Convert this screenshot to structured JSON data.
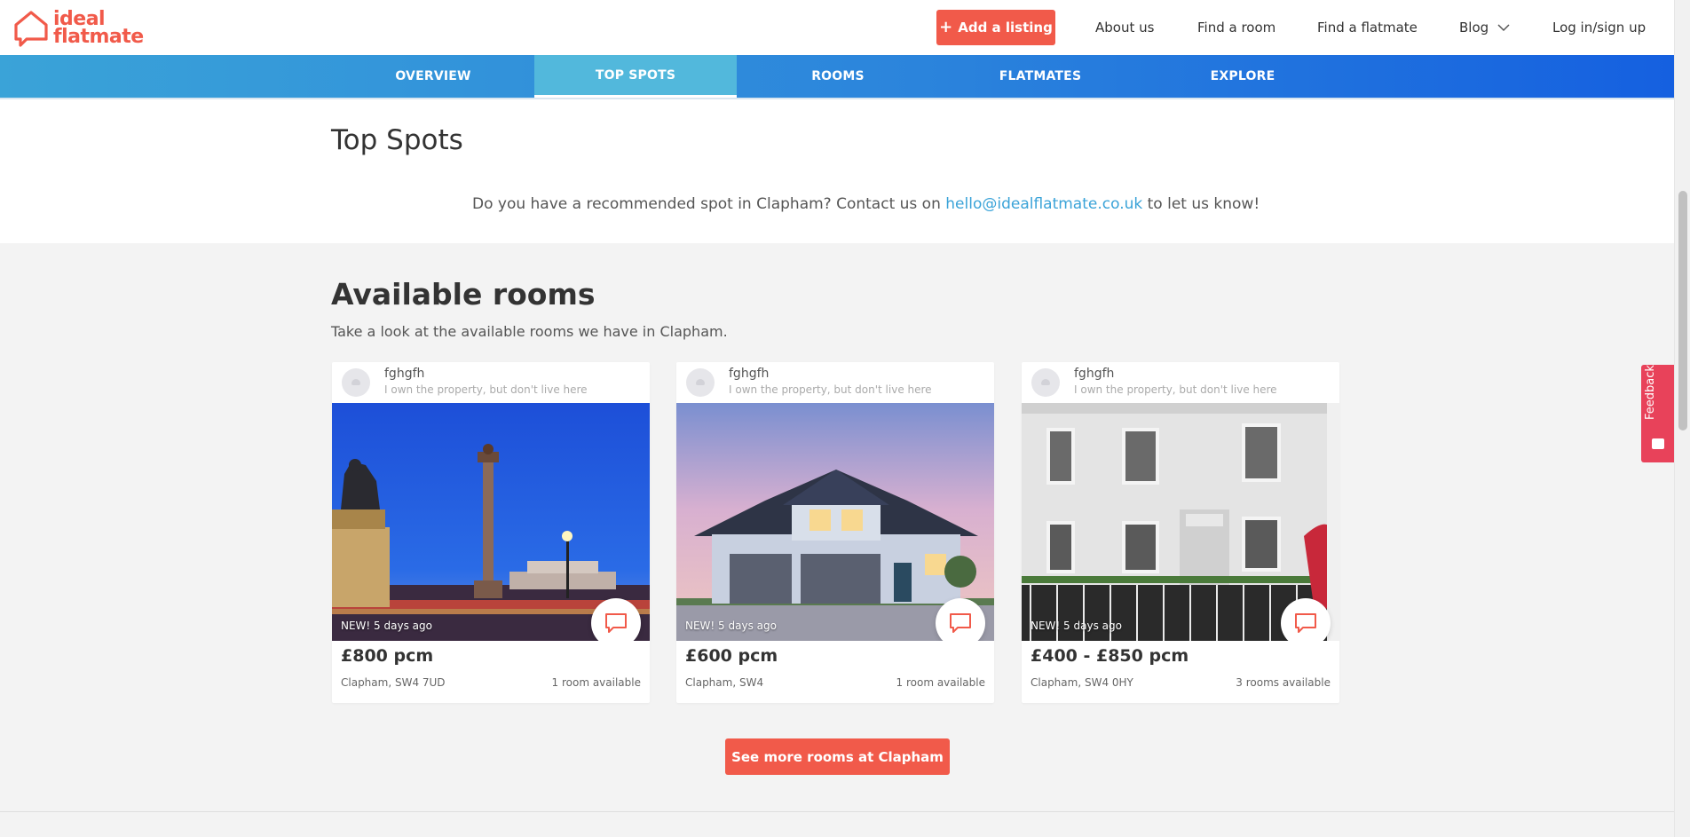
{
  "brand": {
    "name_line1": "ideal",
    "name_line2": "flatmate",
    "color": "#f15a4a"
  },
  "header": {
    "add_listing": "Add a listing",
    "links": {
      "about": "About us",
      "find_room": "Find a room",
      "find_flatmate": "Find a flatmate",
      "blog": "Blog",
      "login": "Log in/sign up"
    }
  },
  "tabs": [
    {
      "label": "OVERVIEW",
      "active": false
    },
    {
      "label": "TOP SPOTS",
      "active": true
    },
    {
      "label": "ROOMS",
      "active": false
    },
    {
      "label": "FLATMATES",
      "active": false
    },
    {
      "label": "EXPLORE",
      "active": false
    }
  ],
  "top_spots": {
    "title": "Top Spots",
    "text_before": "Do you have a recommended spot in Clapham? Contact us on ",
    "email": "hello@idealflatmate.co.uk",
    "text_after": " to let us know!"
  },
  "available_rooms": {
    "title": "Available rooms",
    "subtitle": "Take a look at the available rooms we have in Clapham.",
    "cards": [
      {
        "name": "fghgfh",
        "role": "I own the property, but don't live here",
        "image": "trafalgar-square-night",
        "badge": "NEW! 5 days ago",
        "price": "£800 pcm",
        "location": "Clapham, SW4 7UD",
        "availability": "1 room available"
      },
      {
        "name": "fghgfh",
        "role": "I own the property, but don't live here",
        "image": "suburban-house-dusk",
        "badge": "NEW! 5 days ago",
        "price": "£600 pcm",
        "location": "Clapham, SW4",
        "availability": "1 room available"
      },
      {
        "name": "fghgfh",
        "role": "I own the property, but don't live here",
        "image": "white-townhouse-street",
        "badge": "NEW! 5 days ago",
        "price": "£400 - £850 pcm",
        "location": "Clapham, SW4 0HY",
        "availability": "3 rooms available"
      }
    ],
    "see_more": "See more rooms at Clapham"
  },
  "feedback": {
    "label": "Feedback",
    "color": "#e8425a"
  },
  "colors": {
    "accent": "#f15a4a",
    "link": "#3aa3d8",
    "tab_gradient_start": "#3aa3d8",
    "tab_gradient_end": "#1560e0"
  }
}
